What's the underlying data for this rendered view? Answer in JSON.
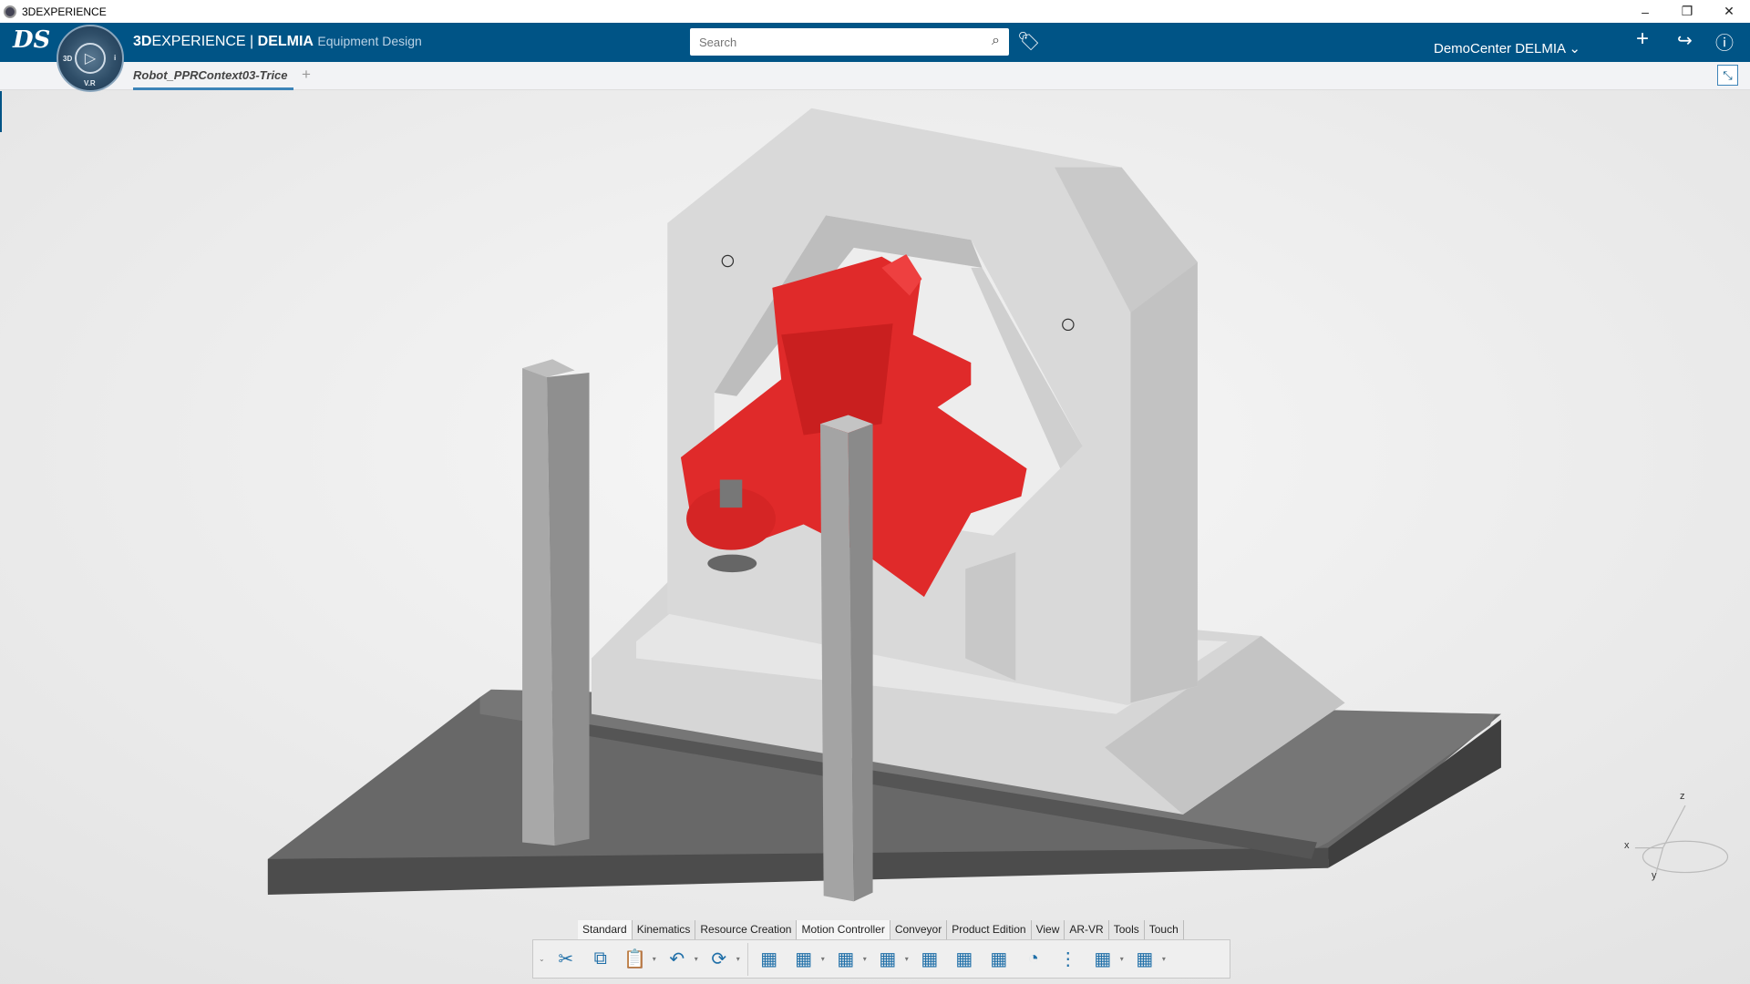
{
  "window": {
    "title": "3DEXPERIENCE",
    "controls": [
      "minimize",
      "restore",
      "close"
    ]
  },
  "header": {
    "brand_bold": "3D",
    "brand_rest": "EXPERIENCE",
    "separator": " | ",
    "product": "DELMIA",
    "app": "Equipment Design",
    "search_placeholder": "Search",
    "user": "DemoCenter DELMIA",
    "compass_labels": [
      "3D",
      "V.R",
      "i"
    ]
  },
  "tabs": {
    "document": "Robot_PPRContext03-Trice",
    "add": "+"
  },
  "toolbar": {
    "tabs": [
      "Standard",
      "Kinematics",
      "Resource Creation",
      "Motion Controller",
      "Conveyor",
      "Product Edition",
      "View",
      "AR-VR",
      "Tools",
      "Touch"
    ],
    "active_tab": "Motion Controller",
    "icons": [
      "cut-icon",
      "copy-icon",
      "paste-icon",
      "undo-icon",
      "update-icon",
      "device-icon",
      "device-settings-icon",
      "robot-icon",
      "device-product-icon",
      "mount-icon",
      "home-position-icon",
      "joint-table-icon",
      "speed-icon",
      "abc-sequence-icon",
      "tool-attach-icon",
      "device-tools-icon"
    ]
  },
  "compass_axes": {
    "x": "x",
    "y": "y",
    "z": "z"
  },
  "colors": {
    "header": "#005486",
    "robot": "#e02a2a",
    "accent": "#3d84b8"
  }
}
